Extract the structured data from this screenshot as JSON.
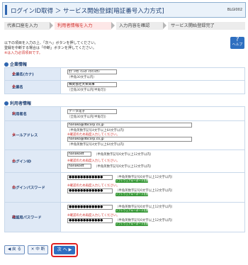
{
  "header": {
    "title": "ログインID取得 ＞ サービス開始登録[暗証番号入力方式]",
    "screen_code": "BLGI002"
  },
  "steps": [
    {
      "label": "代表口座を入力",
      "state": "done"
    },
    {
      "label": "利用者情報を入力",
      "state": "current"
    },
    {
      "label": "入力内容を確認",
      "state": "todo"
    },
    {
      "label": "サービス開始登録完了",
      "state": "todo"
    }
  ],
  "intro": {
    "line1": "以下の項目を入力の上、「次へ」ボタンを押してください。",
    "line2": "登録を中断する場合は「中断」ボタンを押してください。",
    "required_note": "※は入力必須項目です。"
  },
  "help": {
    "icon": "?",
    "label": "ヘルプ"
  },
  "company": {
    "heading": "企業情報",
    "name_kana": {
      "label": "企業名(カナ)",
      "value": "ｶﾌﾞｼｷｶﾞｲｼｬﾀﾞｲｴｲｼｮｳｼﾞ",
      "hint": "（半角30文字以内）"
    },
    "name": {
      "label": "企業名",
      "value": "株式会社大栄商事",
      "hint": "（全角30文字以内[半角可]）"
    }
  },
  "user": {
    "heading": "利用者情報",
    "user_name": {
      "label": "利用者名",
      "value": "データ花子",
      "hint": "（全角30文字以内[半角可]）"
    },
    "email": {
      "label": "メールアドレス",
      "value": "hanako@dbcorp.co.jp",
      "hint": "（半角英数字記号4文字以上64文字以内）",
      "confirm_note": "※確認のため再度入力してください。",
      "confirm_value": "hanako@dbcorp.co.jp"
    },
    "login_id": {
      "label": "ログインID",
      "value": "hanakodt",
      "hint": "（半角英数字記号6文字以上12文字以内）",
      "confirm_note": "※確認のため再度入力してください。",
      "confirm_value": "hanakodt"
    },
    "login_password": {
      "label": "ログインパスワード",
      "value": "●●●●●●●●●●●●",
      "hint": "（半角英数字記号6文字以上12文字以内）",
      "keyboard": "ソフトウェアキーボードを開く",
      "confirm_note": "※確認のため再度入力してください。",
      "confirm_value": "●●●●●●●●●●●●"
    },
    "confirm_password": {
      "label": "確認用パスワード",
      "value": "●●●●●●●●●●●●",
      "hint": "（半角英数字記号6文字以上12文字以内）",
      "keyboard": "ソフトウェアキーボードを開く",
      "confirm_note": "※確認のため再度入力してください。",
      "confirm_value": "●●●●●●●●●●●●"
    }
  },
  "buttons": {
    "back": "◀ 戻 る",
    "abort": "✕ 中 断",
    "next": "次 へ ▶"
  }
}
